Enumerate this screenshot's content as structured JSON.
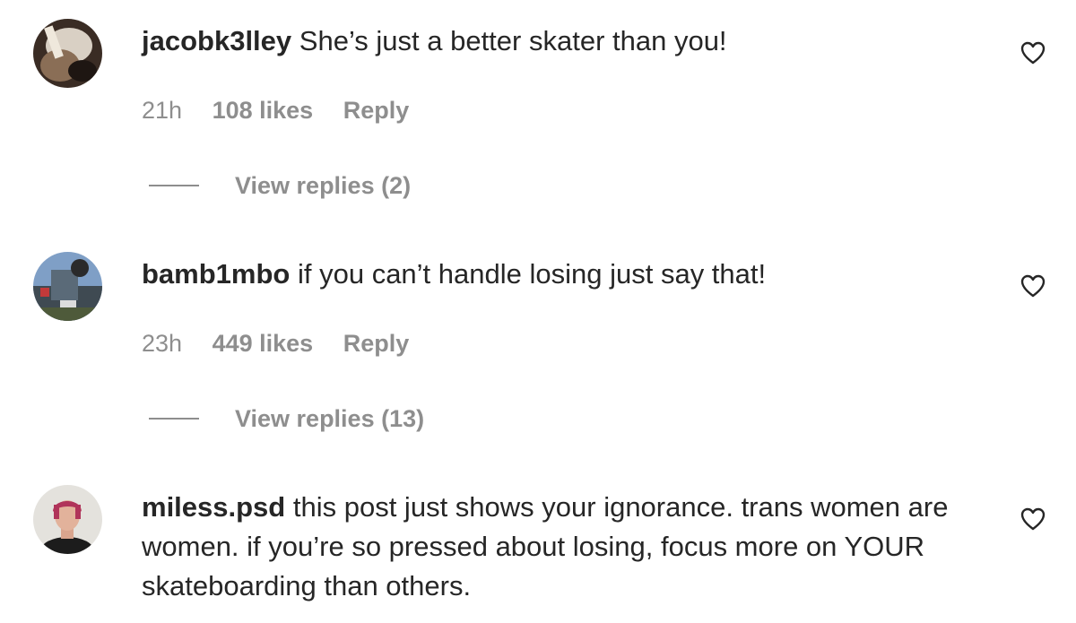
{
  "comments": [
    {
      "username": "jacobk3lley",
      "text": "She’s just a better skater than you!",
      "time": "21h",
      "likes": "108 likes",
      "reply": "Reply",
      "view_replies": "View replies (2)"
    },
    {
      "username": "bamb1mbo",
      "text": "if you can’t handle losing just say that!",
      "time": "23h",
      "likes": "449 likes",
      "reply": "Reply",
      "view_replies": "View replies (13)"
    },
    {
      "username": "miless.psd",
      "text": "this post just shows your ignorance. trans women are women. if you’re so pressed about losing, focus more on YOUR skateboarding than others."
    }
  ],
  "colors": {
    "primary_text": "#262626",
    "secondary_text": "#8e8e8e",
    "background": "#ffffff"
  },
  "icons": {
    "like": "heart-outline-icon"
  }
}
